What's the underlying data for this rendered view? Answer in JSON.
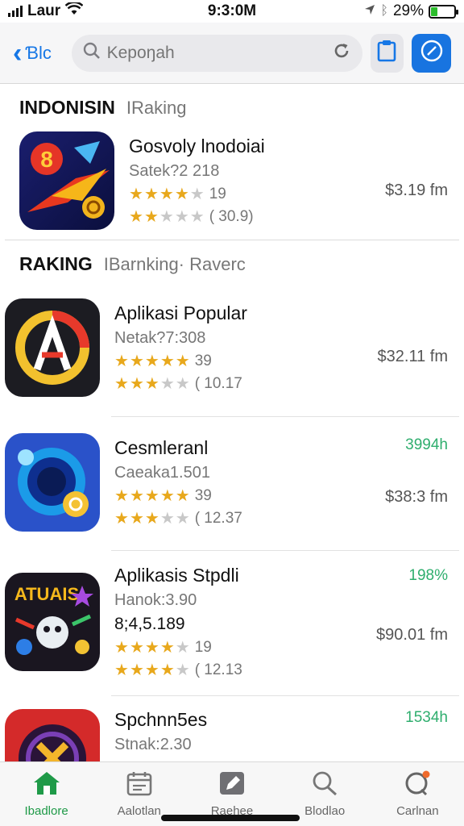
{
  "status": {
    "carrier": "Laur",
    "time": "9:3:0M",
    "battery": "29%",
    "battery_level": 0.29
  },
  "nav": {
    "back_label": "Ɓlc",
    "search_placeholder": "Kepoŋah"
  },
  "sections": [
    {
      "title": "INDONISIN",
      "subtitle": "IRaking",
      "apps": [
        {
          "name": "Gosvoly lnodoiai",
          "developer": "Satek?2 218",
          "stars": 4,
          "rating_count": "19",
          "stars2": 2,
          "rating_count2": "( 30.9)",
          "price": "$3.19 fm",
          "badge": ""
        }
      ]
    },
    {
      "title": "RAKING",
      "subtitle": "IBarnking· Raverc",
      "apps": [
        {
          "name": "Aplikasi Popular",
          "developer": "Netak?7:308",
          "stars": 5,
          "rating_count": "39",
          "stars2": 3,
          "rating_count2": "( 10.17",
          "price": "$32.11 fm",
          "badge": ""
        },
        {
          "name": "Cesmleranl",
          "developer": "Caeaka1.501",
          "stars": 5,
          "rating_count": "39",
          "stars2": 3,
          "rating_count2": "( 12.37",
          "price": "$38:3 fm",
          "badge": "3994h"
        },
        {
          "name": "Aplikasis Stpdli",
          "developer": "Hanok:3.90",
          "extra": "8;4,5.189",
          "stars": 4,
          "rating_count": "19",
          "stars2": 4,
          "rating_count2": "( 12.13",
          "price": "$90.01 fm",
          "badge": "198%"
        },
        {
          "name": "Spchnn5es",
          "developer": "Stnak:2.30",
          "price": "",
          "badge": "1534h"
        }
      ]
    }
  ],
  "tabs": [
    {
      "label": "Ibadlore",
      "icon": "home-icon",
      "active": true
    },
    {
      "label": "Aalotlan",
      "icon": "calendar-icon",
      "active": false
    },
    {
      "label": "Raehee",
      "icon": "pencil-icon",
      "active": false
    },
    {
      "label": "Blodlao",
      "icon": "search-icon",
      "active": false
    },
    {
      "label": "Carlnan",
      "icon": "chat-icon",
      "active": false
    }
  ],
  "colors": {
    "accent": "#1677e6",
    "active_tab": "#1f9a48",
    "star": "#e8a81c",
    "badge": "#2fae6e"
  }
}
